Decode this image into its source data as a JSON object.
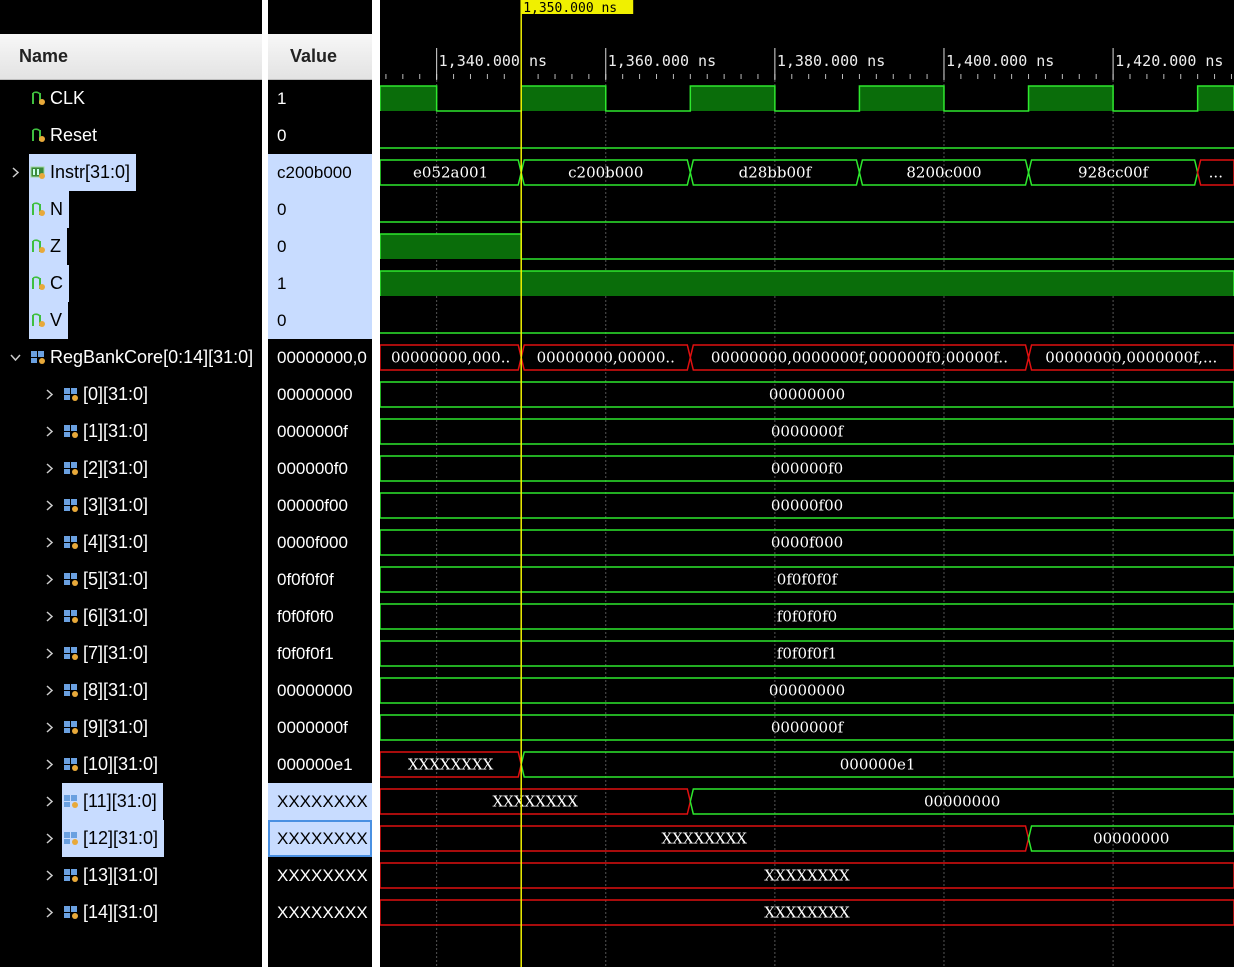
{
  "header": {
    "name_col": "Name",
    "value_col": "Value"
  },
  "cursor": {
    "time_label": "1,350.000 ns",
    "time_ns": 1350
  },
  "timeline": {
    "start_ns": 1333.3,
    "end_ns": 1434.3,
    "ticks": [
      {
        "ns": 1340,
        "label": "1,340.000 ns"
      },
      {
        "ns": 1360,
        "label": "1,360.000 ns"
      },
      {
        "ns": 1380,
        "label": "1,380.000 ns"
      },
      {
        "ns": 1400,
        "label": "1,400.000 ns"
      },
      {
        "ns": 1420,
        "label": "1,420.000 ns"
      }
    ]
  },
  "colors": {
    "wave": "#2ee82e",
    "fill": "#0a6d0a",
    "undefined": "#e01010",
    "cursor": "#f0f000",
    "select": "#c8dcff"
  },
  "signals": [
    {
      "name": "CLK",
      "value": "1",
      "icon": "bit-signal-icon",
      "kind": "bit",
      "highs": [
        [
          1333.3,
          1340
        ],
        [
          1350,
          1360
        ],
        [
          1370,
          1380
        ],
        [
          1390,
          1400
        ],
        [
          1410,
          1420
        ],
        [
          1430,
          1434.3
        ]
      ]
    },
    {
      "name": "Reset",
      "value": "0",
      "icon": "bit-signal-icon",
      "kind": "bit",
      "highs": []
    },
    {
      "name": "Instr[31:0]",
      "value": "c200b000",
      "icon": "bus-signal-icon",
      "kind": "bus",
      "expandable": true,
      "selected": true,
      "segs": [
        {
          "from": 1333.3,
          "to": 1350,
          "label": "e052a001",
          "undef": false
        },
        {
          "from": 1350,
          "to": 1370,
          "label": "c200b000",
          "undef": false
        },
        {
          "from": 1370,
          "to": 1390,
          "label": "d28bb00f",
          "undef": false
        },
        {
          "from": 1390,
          "to": 1410,
          "label": "8200c000",
          "undef": false
        },
        {
          "from": 1410,
          "to": 1430,
          "label": "928cc00f",
          "undef": false
        },
        {
          "from": 1430,
          "to": 1434.3,
          "label": "...",
          "undef": true
        }
      ]
    },
    {
      "name": "N",
      "value": "0",
      "icon": "bit-signal-icon",
      "kind": "bit",
      "selected": true,
      "highs": []
    },
    {
      "name": "Z",
      "value": "0",
      "icon": "bit-signal-icon",
      "kind": "bit",
      "selected": true,
      "highs": [
        [
          1333.3,
          1350
        ]
      ]
    },
    {
      "name": "C",
      "value": "1",
      "icon": "bit-signal-icon",
      "kind": "bit",
      "selected": true,
      "highs": [
        [
          1333.3,
          1434.3
        ]
      ]
    },
    {
      "name": "V",
      "value": "0",
      "icon": "bit-signal-icon",
      "kind": "bit",
      "selected": true,
      "highs": []
    },
    {
      "name": "RegBankCore[0:14][31:0]",
      "value": "00000000,0",
      "icon": "array-signal-icon",
      "kind": "bus",
      "expandable": true,
      "expanded": true,
      "indent": 0,
      "segs": [
        {
          "from": 1333.3,
          "to": 1350,
          "label": "00000000,000..",
          "undef": true
        },
        {
          "from": 1350,
          "to": 1370,
          "label": "00000000,00000..",
          "undef": true
        },
        {
          "from": 1370,
          "to": 1410,
          "label": "00000000,0000000f,000000f0,00000f..",
          "undef": true
        },
        {
          "from": 1410,
          "to": 1434.3,
          "label": "00000000,0000000f,...",
          "undef": true
        }
      ]
    },
    {
      "name": "[0][31:0]",
      "value": "00000000",
      "icon": "array-signal-icon",
      "kind": "bus",
      "expandable": true,
      "indent": 1,
      "segs": [
        {
          "from": 1333.3,
          "to": 1434.3,
          "label": "00000000",
          "undef": false
        }
      ]
    },
    {
      "name": "[1][31:0]",
      "value": "0000000f",
      "icon": "array-signal-icon",
      "kind": "bus",
      "expandable": true,
      "indent": 1,
      "segs": [
        {
          "from": 1333.3,
          "to": 1434.3,
          "label": "0000000f",
          "undef": false
        }
      ]
    },
    {
      "name": "[2][31:0]",
      "value": "000000f0",
      "icon": "array-signal-icon",
      "kind": "bus",
      "expandable": true,
      "indent": 1,
      "segs": [
        {
          "from": 1333.3,
          "to": 1434.3,
          "label": "000000f0",
          "undef": false
        }
      ]
    },
    {
      "name": "[3][31:0]",
      "value": "00000f00",
      "icon": "array-signal-icon",
      "kind": "bus",
      "expandable": true,
      "indent": 1,
      "segs": [
        {
          "from": 1333.3,
          "to": 1434.3,
          "label": "00000f00",
          "undef": false
        }
      ]
    },
    {
      "name": "[4][31:0]",
      "value": "0000f000",
      "icon": "array-signal-icon",
      "kind": "bus",
      "expandable": true,
      "indent": 1,
      "segs": [
        {
          "from": 1333.3,
          "to": 1434.3,
          "label": "0000f000",
          "undef": false
        }
      ]
    },
    {
      "name": "[5][31:0]",
      "value": "0f0f0f0f",
      "icon": "array-signal-icon",
      "kind": "bus",
      "expandable": true,
      "indent": 1,
      "segs": [
        {
          "from": 1333.3,
          "to": 1434.3,
          "label": "0f0f0f0f",
          "undef": false
        }
      ]
    },
    {
      "name": "[6][31:0]",
      "value": "f0f0f0f0",
      "icon": "array-signal-icon",
      "kind": "bus",
      "expandable": true,
      "indent": 1,
      "segs": [
        {
          "from": 1333.3,
          "to": 1434.3,
          "label": "f0f0f0f0",
          "undef": false
        }
      ]
    },
    {
      "name": "[7][31:0]",
      "value": "f0f0f0f1",
      "icon": "array-signal-icon",
      "kind": "bus",
      "expandable": true,
      "indent": 1,
      "segs": [
        {
          "from": 1333.3,
          "to": 1434.3,
          "label": "f0f0f0f1",
          "undef": false
        }
      ]
    },
    {
      "name": "[8][31:0]",
      "value": "00000000",
      "icon": "array-signal-icon",
      "kind": "bus",
      "expandable": true,
      "indent": 1,
      "segs": [
        {
          "from": 1333.3,
          "to": 1434.3,
          "label": "00000000",
          "undef": false
        }
      ]
    },
    {
      "name": "[9][31:0]",
      "value": "0000000f",
      "icon": "array-signal-icon",
      "kind": "bus",
      "expandable": true,
      "indent": 1,
      "segs": [
        {
          "from": 1333.3,
          "to": 1434.3,
          "label": "0000000f",
          "undef": false
        }
      ]
    },
    {
      "name": "[10][31:0]",
      "value": "000000e1",
      "icon": "array-signal-icon",
      "kind": "bus",
      "expandable": true,
      "indent": 1,
      "segs": [
        {
          "from": 1333.3,
          "to": 1350,
          "label": "XXXXXXXX",
          "undef": true
        },
        {
          "from": 1350,
          "to": 1434.3,
          "label": "000000e1",
          "undef": false
        }
      ]
    },
    {
      "name": "[11][31:0]",
      "value": "XXXXXXXX",
      "icon": "array-signal-icon",
      "kind": "bus",
      "expandable": true,
      "indent": 1,
      "selected": true,
      "segs": [
        {
          "from": 1333.3,
          "to": 1370,
          "label": "XXXXXXXX",
          "undef": true
        },
        {
          "from": 1370,
          "to": 1434.3,
          "label": "00000000",
          "undef": false
        }
      ]
    },
    {
      "name": "[12][31:0]",
      "value": "XXXXXXXX",
      "icon": "array-signal-icon",
      "kind": "bus",
      "expandable": true,
      "indent": 1,
      "selected": true,
      "focused": true,
      "segs": [
        {
          "from": 1333.3,
          "to": 1410,
          "label": "XXXXXXXX",
          "undef": true
        },
        {
          "from": 1410,
          "to": 1434.3,
          "label": "00000000",
          "undef": false
        }
      ]
    },
    {
      "name": "[13][31:0]",
      "value": "XXXXXXXX",
      "icon": "array-signal-icon",
      "kind": "bus",
      "expandable": true,
      "indent": 1,
      "segs": [
        {
          "from": 1333.3,
          "to": 1434.3,
          "label": "XXXXXXXX",
          "undef": true
        }
      ]
    },
    {
      "name": "[14][31:0]",
      "value": "XXXXXXXX",
      "icon": "array-signal-icon",
      "kind": "bus",
      "expandable": true,
      "indent": 1,
      "segs": [
        {
          "from": 1333.3,
          "to": 1434.3,
          "label": "XXXXXXXX",
          "undef": true
        }
      ]
    }
  ]
}
